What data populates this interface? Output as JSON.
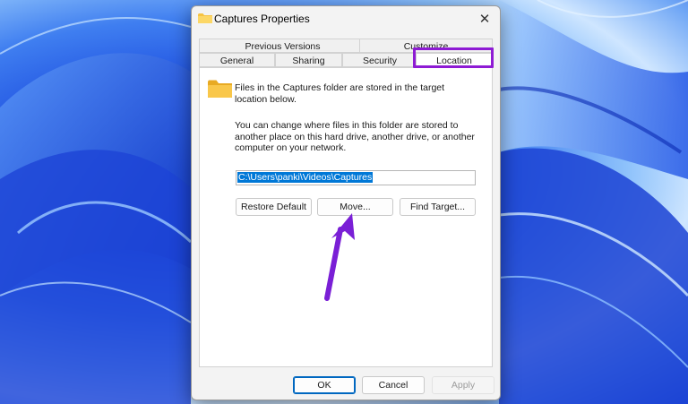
{
  "window": {
    "title": "Captures Properties",
    "close_label": "✕"
  },
  "tabs": {
    "row1": [
      "Previous Versions",
      "Customize"
    ],
    "row2": [
      "General",
      "Sharing",
      "Security",
      "Location"
    ],
    "active": "Location"
  },
  "location": {
    "description1": "Files in the Captures folder are stored in the target location below.",
    "description2": "You can change where files in this folder are stored to another place on this hard drive, another drive, or another computer on your network.",
    "path": "C:\\Users\\panki\\Videos\\Captures",
    "buttons": {
      "restore": "Restore Default",
      "move": "Move...",
      "find": "Find Target..."
    }
  },
  "footer": {
    "ok": "OK",
    "cancel": "Cancel",
    "apply": "Apply"
  },
  "colors": {
    "highlight": "#8e1bd4",
    "arrow": "#7a1fd6",
    "selection": "#0078d7",
    "folder": "#f6c343"
  }
}
